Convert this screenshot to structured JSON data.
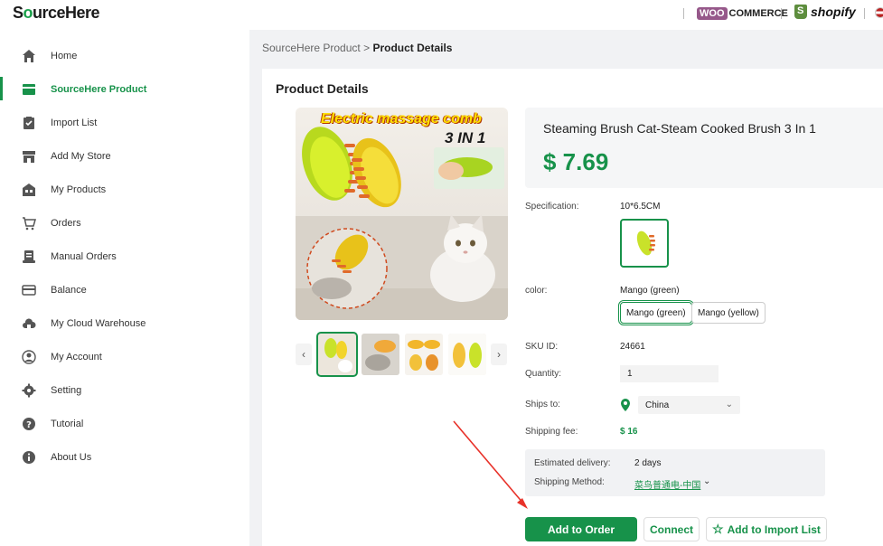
{
  "brand": {
    "name_prefix": "S",
    "name_o": "o",
    "name_rest": "urceHere"
  },
  "integrations": {
    "woo_label": "WOO",
    "woo_commerce": "COMMERCE",
    "shopify_label": "shopify"
  },
  "sidebar": {
    "items": [
      {
        "label": "Home",
        "icon": "home-icon"
      },
      {
        "label": "SourceHere Product",
        "icon": "product-icon",
        "active": true
      },
      {
        "label": "Import List",
        "icon": "import-list-icon"
      },
      {
        "label": "Add My Store",
        "icon": "store-icon"
      },
      {
        "label": "My Products",
        "icon": "my-products-icon"
      },
      {
        "label": "Orders",
        "icon": "cart-icon"
      },
      {
        "label": "Manual Orders",
        "icon": "manual-orders-icon"
      },
      {
        "label": "Balance",
        "icon": "balance-icon"
      },
      {
        "label": "My Cloud Warehouse",
        "icon": "cloud-warehouse-icon"
      },
      {
        "label": "My Account",
        "icon": "account-icon"
      },
      {
        "label": "Setting",
        "icon": "gear-icon"
      },
      {
        "label": "Tutorial",
        "icon": "question-icon"
      },
      {
        "label": "About Us",
        "icon": "info-icon"
      }
    ]
  },
  "breadcrumb": {
    "parent": "SourceHere Product",
    "separator": ">",
    "current": "Product Details"
  },
  "page": {
    "title": "Product Details"
  },
  "product": {
    "image_banner": "Electric massage comb",
    "image_sub": "3 IN 1",
    "name": "Steaming Brush Cat-Steam Cooked Brush 3 In 1",
    "price": "$ 7.69",
    "specification_label": "Specification:",
    "specification_value": "10*6.5CM",
    "color_label": "color:",
    "color_value": "Mango (green)",
    "color_options": [
      "Mango (green)",
      "Mango (yellow)"
    ],
    "sku_label": "SKU ID:",
    "sku_value": "24661",
    "quantity_label": "Quantity:",
    "quantity_value": "1",
    "ships_to_label": "Ships to:",
    "ships_to_value": "China",
    "shipping_fee_label": "Shipping fee:",
    "shipping_fee_value": "$ 16",
    "delivery": {
      "estimated_label": "Estimated delivery:",
      "estimated_value": "2 days",
      "method_label": "Shipping Method:",
      "method_value": "菜鸟普通电-中国"
    }
  },
  "thumbnails": {
    "prev": "‹",
    "next": "›"
  },
  "actions": {
    "add_to_order": "Add to Order",
    "connect": "Connect",
    "add_to_import": "Add to Import List"
  },
  "colors": {
    "accent": "#17924a",
    "annotation_arrow": "#e8322a"
  }
}
